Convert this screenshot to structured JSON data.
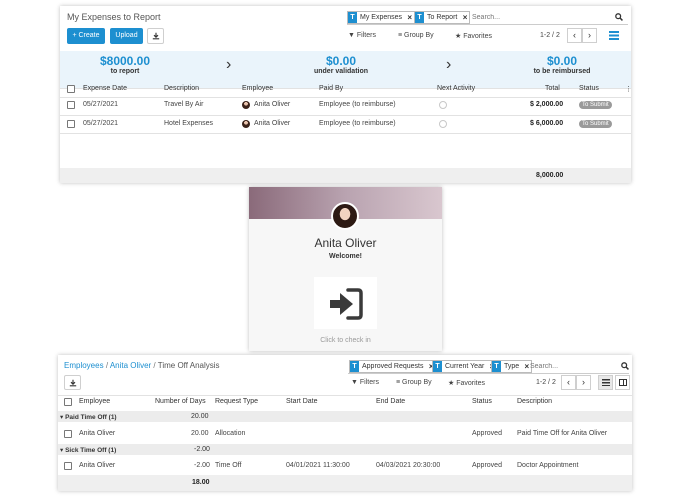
{
  "expenses": {
    "title": "My Expenses to Report",
    "facets": [
      {
        "icon": "T",
        "label": "My Expenses"
      },
      {
        "icon": "T",
        "label": "To Report"
      }
    ],
    "search_placeholder": "Search...",
    "create_label": "+ Create",
    "upload_label": "Upload",
    "filters_label": "Filters",
    "groupby_label": "Group By",
    "favorites_label": "Favorites",
    "pager": "1-2 / 2",
    "summary": [
      {
        "amount": "$8000.00",
        "caption": "to report"
      },
      {
        "amount": "$0.00",
        "caption": "under validation"
      },
      {
        "amount": "$0.00",
        "caption": "to be reimbursed"
      }
    ],
    "columns": [
      "Expense Date",
      "Description",
      "Employee",
      "Paid By",
      "Next Activity",
      "Total",
      "Status"
    ],
    "rows": [
      {
        "date": "05/27/2021",
        "description": "Travel By Air",
        "employee": "Anita Oliver",
        "paid_by": "Employee (to reimburse)",
        "total": "$ 2,000.00",
        "status": "To Submit"
      },
      {
        "date": "05/27/2021",
        "description": "Hotel Expenses",
        "employee": "Anita Oliver",
        "paid_by": "Employee (to reimburse)",
        "total": "$ 6,000.00",
        "status": "To Submit"
      }
    ],
    "footer_total": "8,000.00"
  },
  "checkin": {
    "name": "Anita Oliver",
    "welcome": "Welcome!",
    "hint": "Click to check in"
  },
  "timeoff": {
    "breadcrumb": [
      {
        "label": "Employees",
        "link": true
      },
      {
        "label": "Anita Oliver",
        "link": true
      },
      {
        "label": "Time Off Analysis",
        "link": false
      }
    ],
    "separator": "/",
    "facets": [
      {
        "icon": "T",
        "label": "Approved Requests"
      },
      {
        "icon": "T",
        "label": "Current Year"
      },
      {
        "icon": "T",
        "label": "Type"
      }
    ],
    "search_placeholder": "Search...",
    "filters_label": "Filters",
    "groupby_label": "Group By",
    "favorites_label": "Favorites",
    "pager": "1-2 / 2",
    "columns": [
      "Employee",
      "Number of Days",
      "Request Type",
      "Start Date",
      "End Date",
      "Status",
      "Description"
    ],
    "groups": [
      {
        "label": "▾ Paid Time Off (1)",
        "total": "20.00",
        "row": {
          "employee": "Anita Oliver",
          "days": "20.00",
          "type": "Allocation",
          "start": "",
          "end": "",
          "status": "Approved",
          "description": "Paid Time Off for Anita Oliver"
        }
      },
      {
        "label": "▾ Sick Time Off (1)",
        "total": "-2.00",
        "row": {
          "employee": "Anita Oliver",
          "days": "-2.00",
          "type": "Time Off",
          "start": "04/01/2021 11:30:00",
          "end": "04/03/2021 20:30:00",
          "status": "Approved",
          "description": "Doctor Appointment"
        }
      }
    ],
    "footer_total": "18.00"
  },
  "colors": {
    "accent": "#1d8fd0",
    "summary_bg": "#eaf4fb",
    "badge": "#9a9a9a"
  }
}
